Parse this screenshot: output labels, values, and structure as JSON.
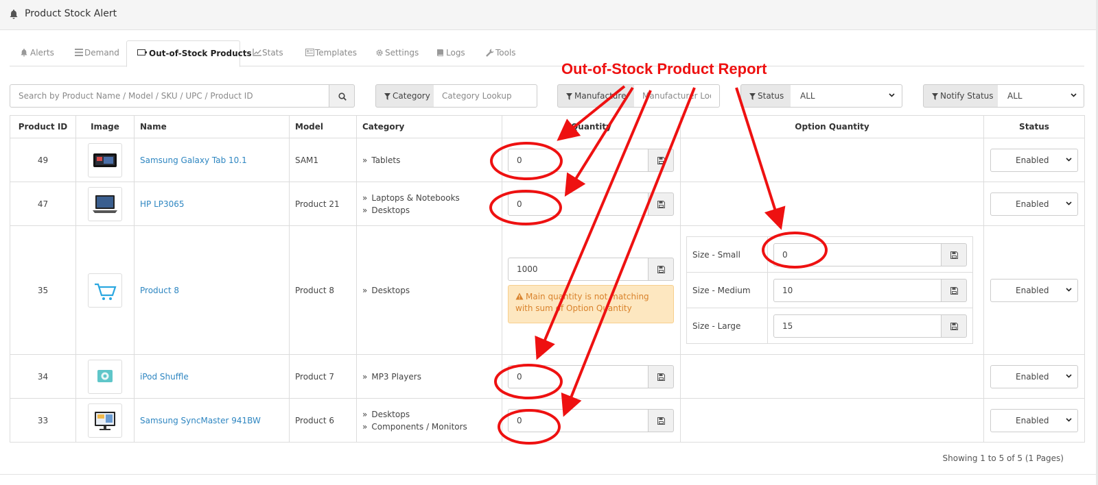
{
  "app": {
    "title": "Product Stock Alert"
  },
  "tabs": [
    {
      "label": "Alerts",
      "icon": "bell-icon"
    },
    {
      "label": "Demand",
      "icon": "list-icon"
    },
    {
      "label": "Out-of-Stock Products",
      "icon": "battery-icon",
      "active": true
    },
    {
      "label": "Stats",
      "icon": "line-chart-icon"
    },
    {
      "label": "Templates",
      "icon": "template-icon"
    },
    {
      "label": "Settings",
      "icon": "gear-icon"
    },
    {
      "label": "Logs",
      "icon": "book-icon"
    },
    {
      "label": "Tools",
      "icon": "wrench-icon"
    }
  ],
  "filters": {
    "search_placeholder": "Search by Product Name / Model / SKU / UPC / Product ID",
    "category_label": "Category",
    "category_placeholder": "Category Lookup",
    "manufacturer_label": "Manufacturer",
    "manufacturer_placeholder": "Manufacturer Lookup",
    "status_label": "Status",
    "status_value": "ALL",
    "notify_label": "Notify Status",
    "notify_value": "ALL"
  },
  "table": {
    "headers": [
      "Product ID",
      "Image",
      "Name",
      "Model",
      "Category",
      "Quantity",
      "Option Quantity",
      "Status"
    ],
    "rows": [
      {
        "id": "49",
        "name": "Samsung Galaxy Tab 10.1",
        "model": "SAM1",
        "categories": [
          "Tablets"
        ],
        "quantity": "0",
        "status": "Enabled"
      },
      {
        "id": "47",
        "name": "HP LP3065",
        "model": "Product 21",
        "categories": [
          "Laptops & Notebooks",
          "Desktops"
        ],
        "quantity": "0",
        "status": "Enabled"
      },
      {
        "id": "35",
        "name": "Product 8",
        "model": "Product 8",
        "categories": [
          "Desktops"
        ],
        "quantity": "1000",
        "warning": "Main quantity is not matching with sum of Option Quantity",
        "options": [
          {
            "label": "Size - Small",
            "value": "0"
          },
          {
            "label": "Size - Medium",
            "value": "10"
          },
          {
            "label": "Size - Large",
            "value": "15"
          }
        ],
        "status": "Enabled"
      },
      {
        "id": "34",
        "name": "iPod Shuffle",
        "model": "Product 7",
        "categories": [
          "MP3 Players"
        ],
        "quantity": "0",
        "status": "Enabled"
      },
      {
        "id": "33",
        "name": "Samsung SyncMaster 941BW",
        "model": "Product 6",
        "categories": [
          "Desktops",
          "Components / Monitors"
        ],
        "quantity": "0",
        "status": "Enabled"
      }
    ]
  },
  "pagination": {
    "text": "Showing 1 to 5 of 5 (1 Pages)"
  },
  "annotation": {
    "title": "Out-of-Stock Product Report",
    "color": "#ee1111"
  }
}
